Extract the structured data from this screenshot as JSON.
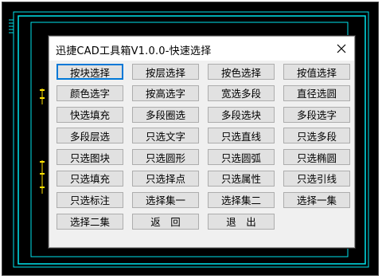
{
  "dialog": {
    "title": "迅捷CAD工具箱V1.0.0-快速选择",
    "close_icon": "close-icon"
  },
  "buttons": [
    {
      "label": "按块选择",
      "focused": true
    },
    {
      "label": "按层选择"
    },
    {
      "label": "按色选择"
    },
    {
      "label": "按值选择"
    },
    {
      "label": "颜色选字"
    },
    {
      "label": "按高选字"
    },
    {
      "label": "宽选多段"
    },
    {
      "label": "直径选圆"
    },
    {
      "label": "快选填充"
    },
    {
      "label": "多段圈选"
    },
    {
      "label": "多段选块"
    },
    {
      "label": "多段选字"
    },
    {
      "label": "多段层选"
    },
    {
      "label": "只选文字"
    },
    {
      "label": "只选直线"
    },
    {
      "label": "只选多段"
    },
    {
      "label": "只选图块"
    },
    {
      "label": "只选圆形"
    },
    {
      "label": "只选圆弧"
    },
    {
      "label": "只选椭圆"
    },
    {
      "label": "只选填充"
    },
    {
      "label": "只选择点"
    },
    {
      "label": "只选属性"
    },
    {
      "label": "只选引线"
    },
    {
      "label": "只选标注"
    },
    {
      "label": "选择集一"
    },
    {
      "label": "选择集二"
    },
    {
      "label": "选择一集"
    },
    {
      "label": "选择二集"
    },
    {
      "label": "返　回"
    },
    {
      "label": "退　出"
    }
  ],
  "colors": {
    "cad_background": "#000000",
    "cad_border": "#00e5ee",
    "cad_accent": "#ffe000",
    "focus": "#0078d7"
  }
}
